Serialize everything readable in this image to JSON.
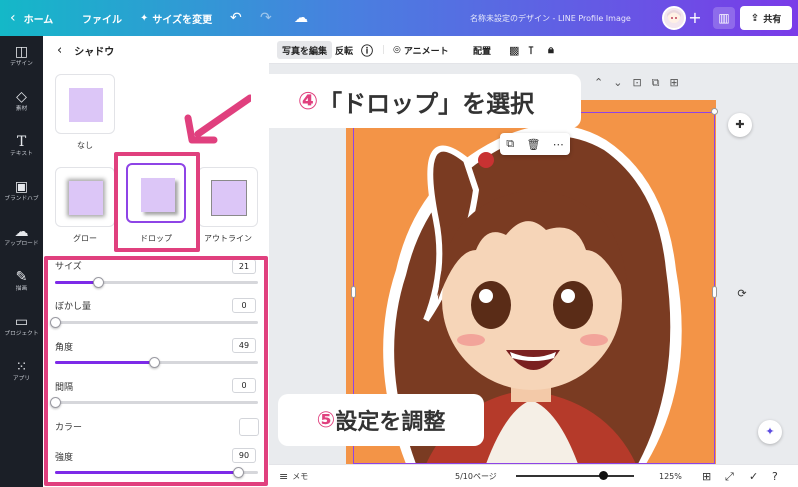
{
  "topbar": {
    "home": "ホーム",
    "file": "ファイル",
    "resize": "サイズを変更",
    "doc_title": "名称未設定のデザイン - LINE Profile Image",
    "share": "共有"
  },
  "rail": [
    {
      "label": "デザイン",
      "icon": "layout-icon"
    },
    {
      "label": "素材",
      "icon": "elements-icon"
    },
    {
      "label": "テキスト",
      "icon": "text-icon"
    },
    {
      "label": "ブランドハブ",
      "icon": "brand-icon"
    },
    {
      "label": "アップロード",
      "icon": "upload-icon"
    },
    {
      "label": "描画",
      "icon": "draw-icon"
    },
    {
      "label": "プロジェクト",
      "icon": "folder-icon"
    },
    {
      "label": "アプリ",
      "icon": "apps-icon"
    }
  ],
  "panel": {
    "title": "シャドウ",
    "shadows": [
      {
        "label": "なし"
      },
      {
        "label": "グロー"
      },
      {
        "label": "ドロップ",
        "selected": true
      },
      {
        "label": "アウトライン"
      }
    ],
    "settings": [
      {
        "label": "サイズ",
        "value": "21",
        "fraction": 0.21
      },
      {
        "label": "ぼかし量",
        "value": "0",
        "fraction": 0.0
      },
      {
        "label": "角度",
        "value": "49",
        "fraction": 0.49
      },
      {
        "label": "間隔",
        "value": "0",
        "fraction": 0.0
      },
      {
        "label": "強度",
        "value": "90",
        "fraction": 0.9
      }
    ],
    "color_label": "カラー"
  },
  "toolbar": {
    "edit_photo": "写真を編集",
    "flip": "反転",
    "animate": "アニメート",
    "position": "配置"
  },
  "callouts": {
    "step4_num": "④",
    "step4": "「ドロップ」を選択",
    "step5_num": "⑤",
    "step5": "設定を調整"
  },
  "footer": {
    "notes": "メモ",
    "pages": "5/10ページ",
    "zoom": "125%",
    "zoom_fraction": 0.74
  },
  "colors": {
    "accent": "#7d2ae8",
    "highlight": "#e0407e",
    "artboard": "#f39447"
  }
}
